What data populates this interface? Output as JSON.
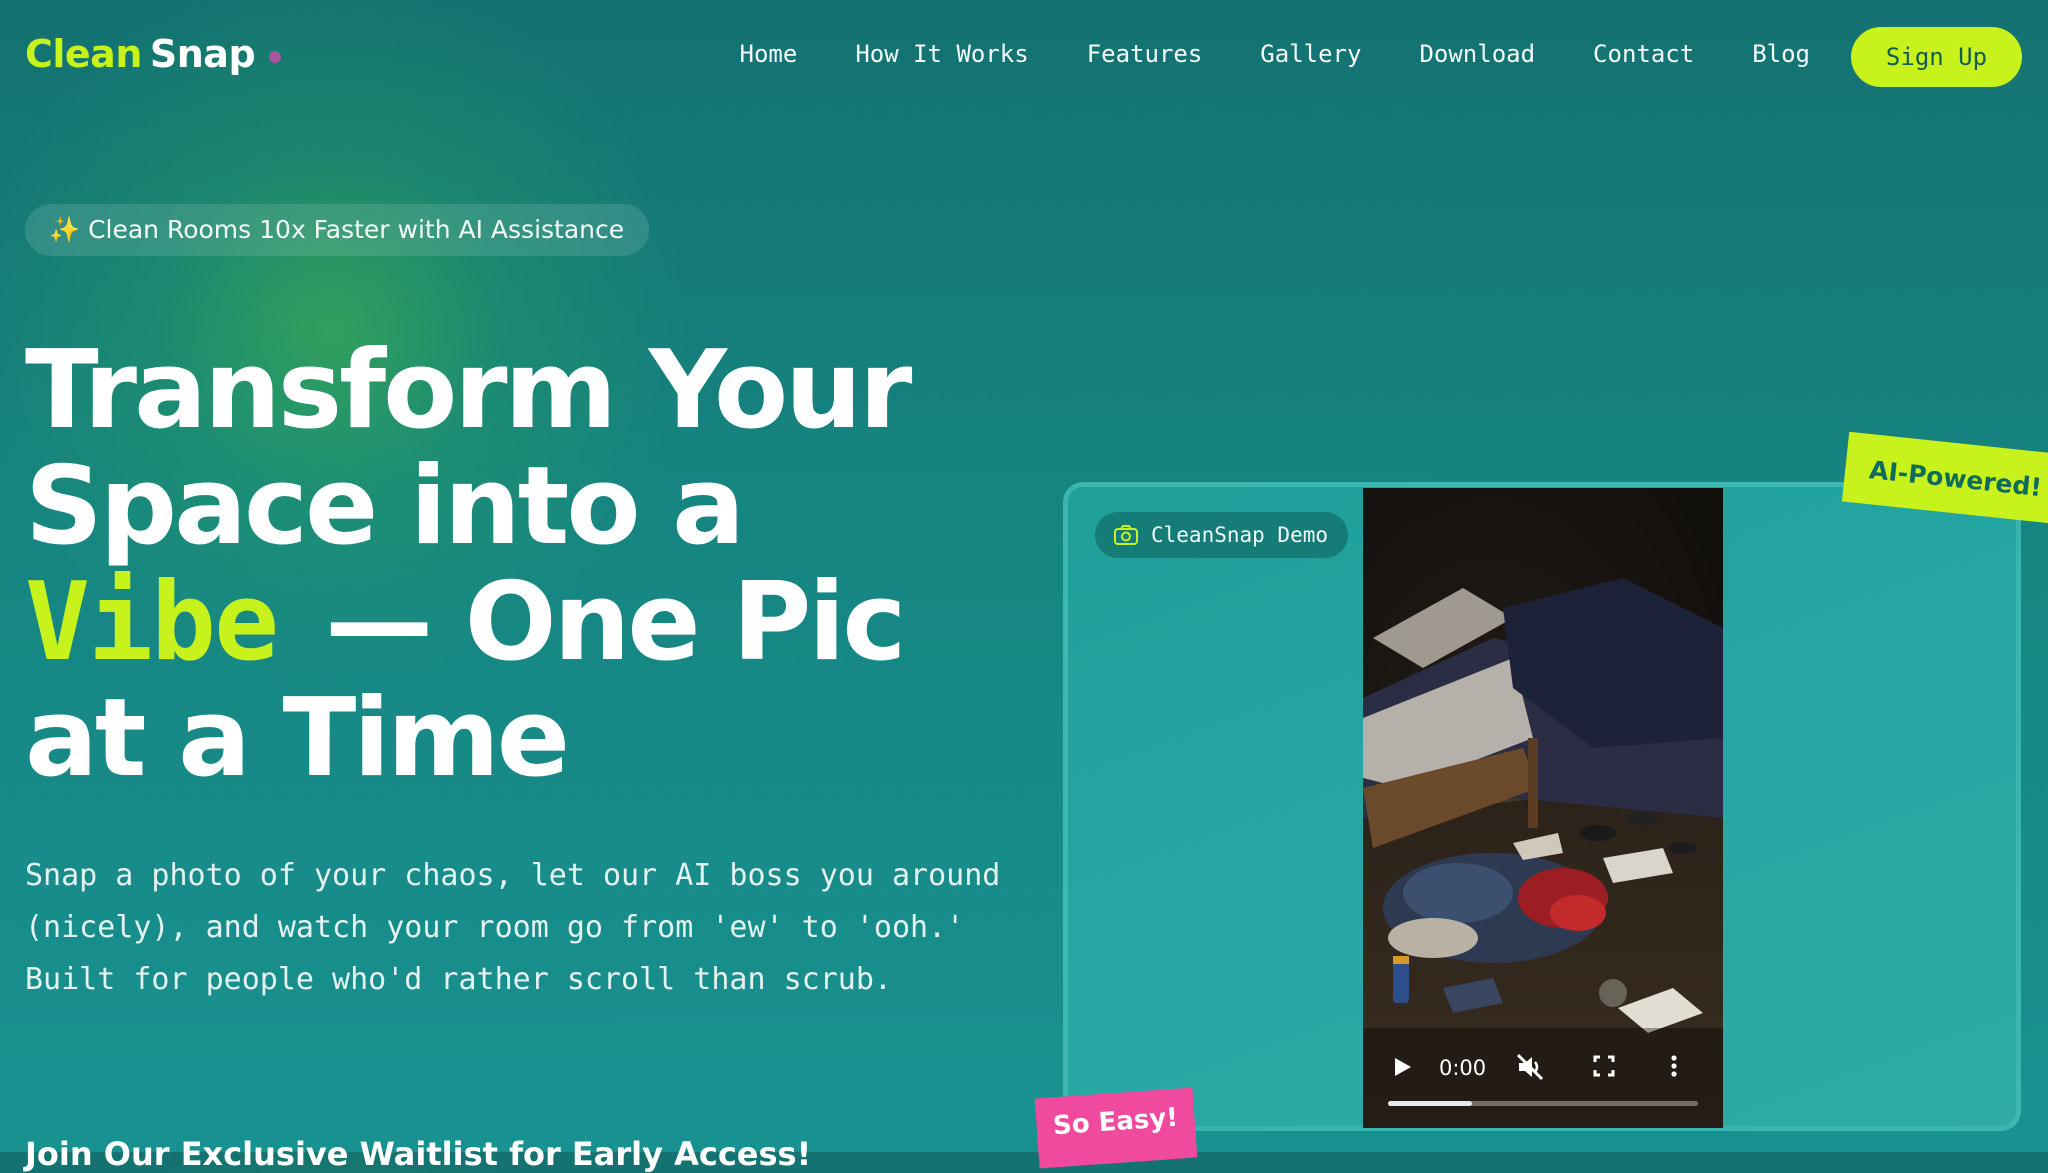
{
  "brand": {
    "name_part1": "Clean",
    "name_part2": "Snap",
    "dot_color": "#a7579f",
    "accent": "#c7f21c"
  },
  "nav": {
    "links": [
      "Home",
      "How It Works",
      "Features",
      "Gallery",
      "Download",
      "Contact",
      "Blog"
    ],
    "signup_label": "Sign Up"
  },
  "hero": {
    "badge_icon": "sparkles-icon",
    "badge_text": "✨ Clean Rooms 10x Faster with AI Assistance",
    "headline_line1": "Transform Your",
    "headline_line2": "Space into a",
    "headline_highlight": "Vibe",
    "headline_line3_rest": "— One Pic",
    "headline_line4": "at a Time",
    "subtitle": "Snap a photo of your chaos, let our AI boss you around (nicely), and watch your room go from 'ew' to 'ooh.' Built for people who'd rather scroll than scrub.",
    "waitlist_heading": "Join Our Exclusive Waitlist for Early Access!"
  },
  "demo": {
    "chip_icon": "camera-icon",
    "chip_label": "CleanSnap Demo",
    "video_time": "0:00",
    "video_progress": 0.27,
    "video_muted": true,
    "controls": [
      "play-icon",
      "mute-icon",
      "fullscreen-icon",
      "more-vertical-icon"
    ]
  },
  "stickers": {
    "ai": "AI-Powered!",
    "easy": "So Easy!",
    "ai_color": "#c7f21c",
    "easy_color": "#f04a9e"
  }
}
